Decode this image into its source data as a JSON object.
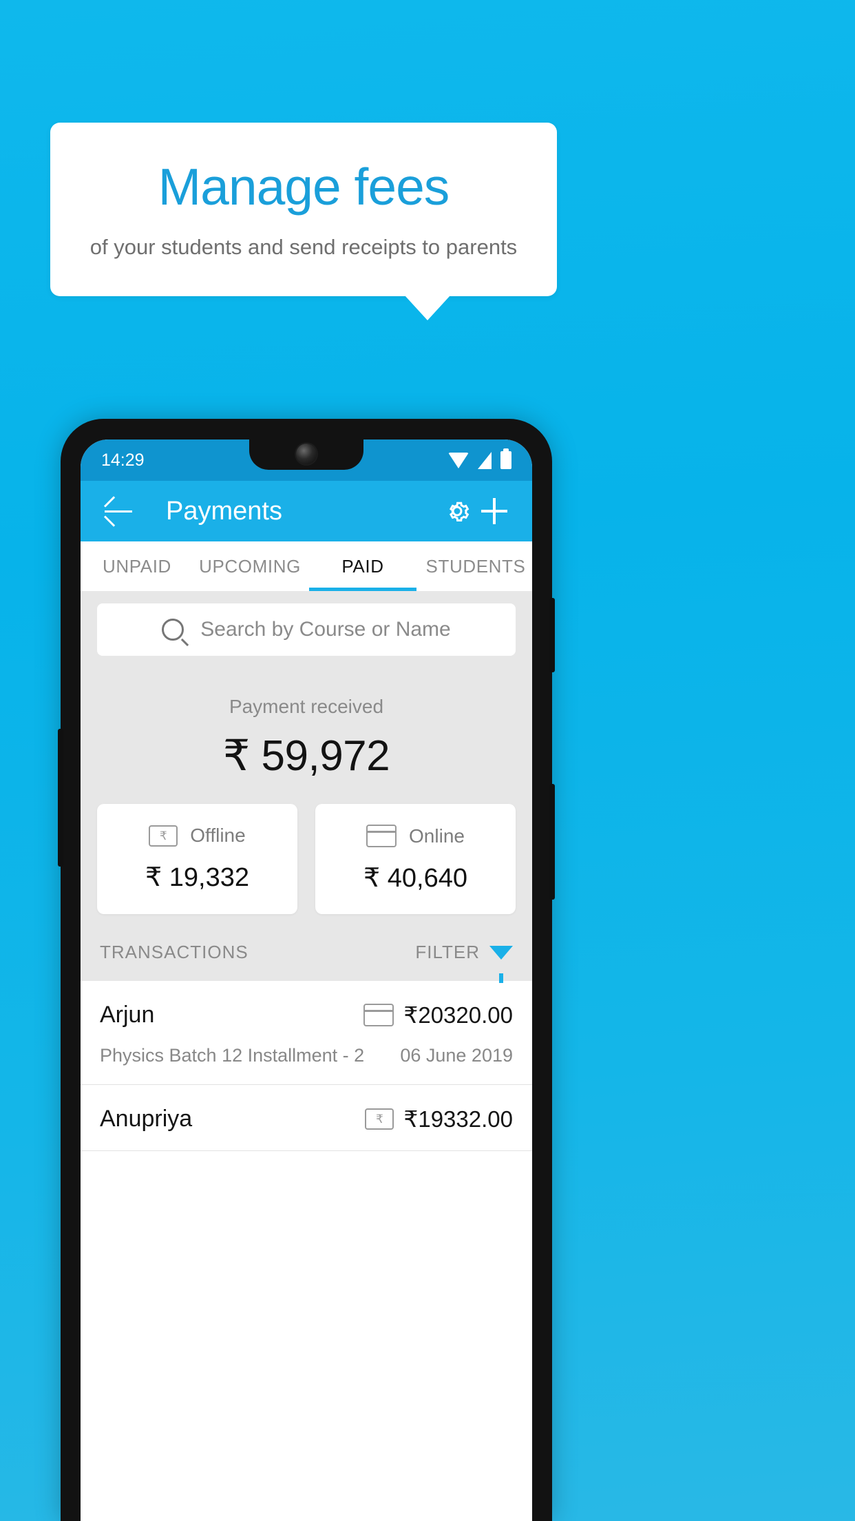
{
  "promo": {
    "title": "Manage fees",
    "subtitle": "of your students and send receipts to parents"
  },
  "colors": {
    "background": "#0fb8ec",
    "accent": "#1ab0e8",
    "statusbar": "#0f94cf",
    "content_bg": "#e7e7e7"
  },
  "phone": {
    "statusbar": {
      "time": "14:29",
      "icons": [
        "wifi-icon",
        "signal-icon",
        "battery-icon"
      ]
    },
    "appbar": {
      "back_icon": "back-arrow-icon",
      "title": "Payments",
      "settings_icon": "gear-icon",
      "add_icon": "plus-icon"
    },
    "tabs": [
      {
        "label": "UNPAID",
        "active": false
      },
      {
        "label": "UPCOMING",
        "active": false
      },
      {
        "label": "PAID",
        "active": true
      },
      {
        "label": "STUDENTS",
        "active": false
      }
    ],
    "search": {
      "icon": "search-icon",
      "placeholder": "Search by Course or Name",
      "value": ""
    },
    "summary": {
      "label": "Payment received",
      "amount": "₹ 59,972",
      "cards": [
        {
          "icon": "rupee-note-icon",
          "label": "Offline",
          "amount": "₹ 19,332"
        },
        {
          "icon": "credit-card-icon",
          "label": "Online",
          "amount": "₹ 40,640"
        }
      ]
    },
    "transactions_header": {
      "label": "TRANSACTIONS",
      "filter_label": "FILTER",
      "filter_icon": "funnel-icon"
    },
    "transactions": [
      {
        "name": "Arjun",
        "description": "Physics Batch 12 Installment - 2",
        "amount": "₹20320.00",
        "date": "06 June 2019",
        "method_icon": "credit-card-icon"
      },
      {
        "name": "Anupriya",
        "description": "",
        "amount": "₹19332.00",
        "date": "",
        "method_icon": "rupee-note-icon"
      }
    ]
  }
}
